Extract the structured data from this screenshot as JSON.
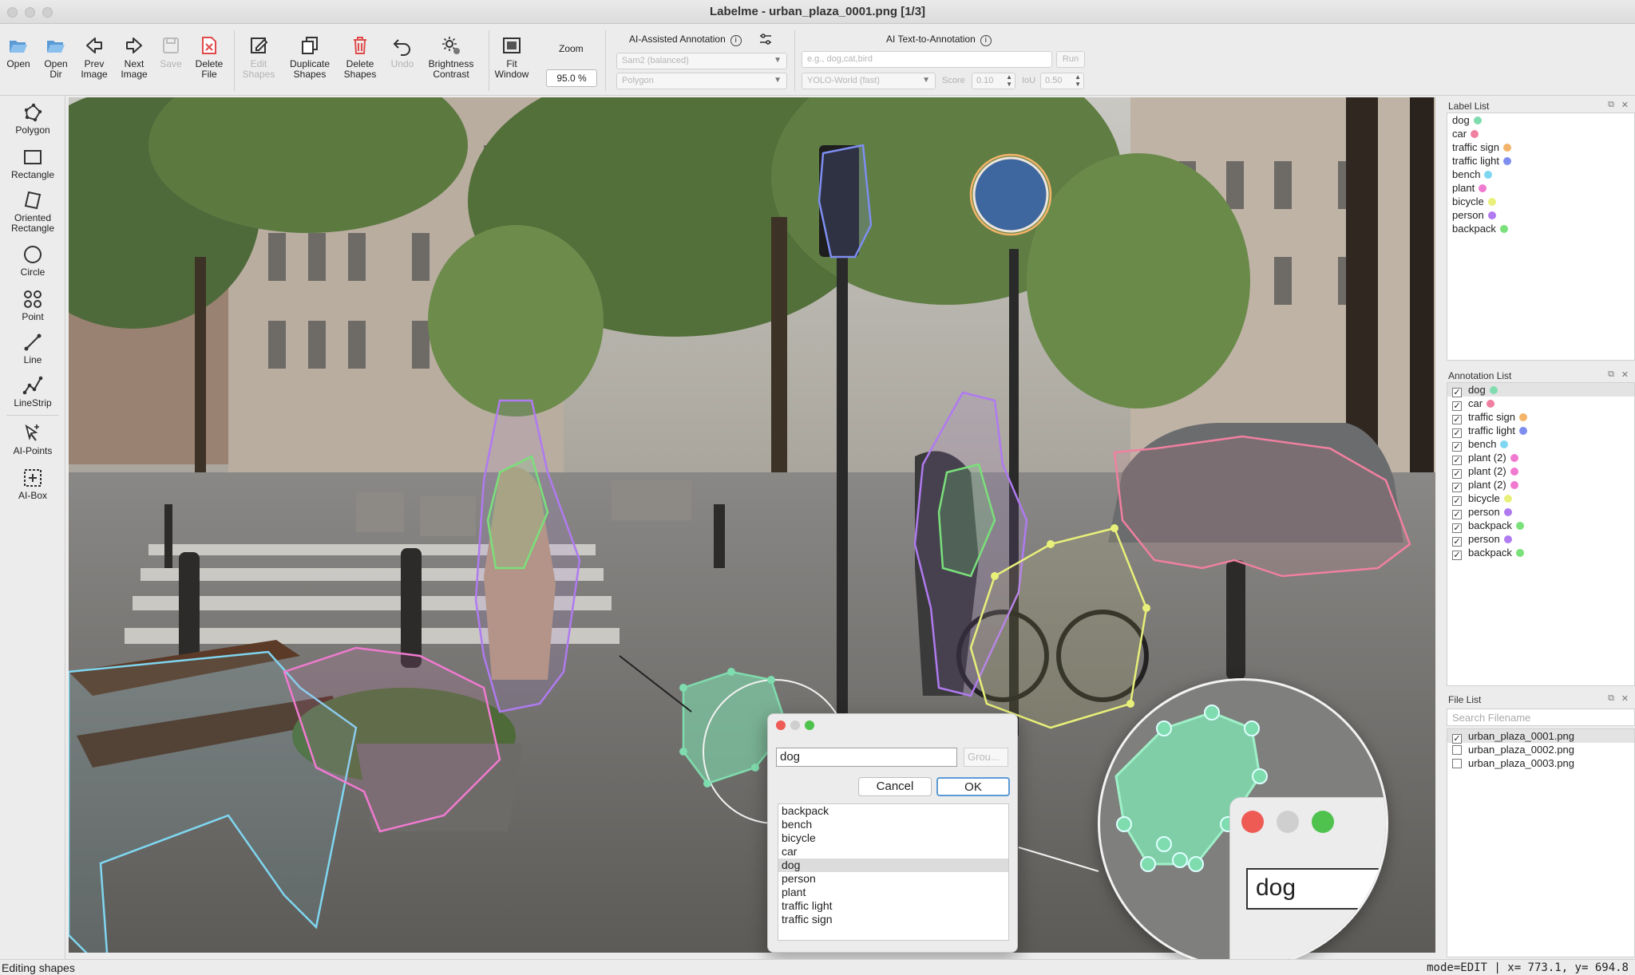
{
  "window": {
    "title": "Labelme - urban_plaza_0001.png [1/3]"
  },
  "toolbar": {
    "open": "Open",
    "open_dir": [
      "Open",
      "Dir"
    ],
    "prev_image": [
      "Prev",
      "Image"
    ],
    "next_image": [
      "Next",
      "Image"
    ],
    "save": "Save",
    "delete_file": [
      "Delete",
      "File"
    ],
    "edit_shapes": [
      "Edit",
      "Shapes"
    ],
    "duplicate_shapes": [
      "Duplicate",
      "Shapes"
    ],
    "delete_shapes": [
      "Delete",
      "Shapes"
    ],
    "undo": "Undo",
    "brightness_contrast": [
      "Brightness",
      "Contrast"
    ],
    "fit_window": [
      "Fit",
      "Window"
    ],
    "zoom_label": "Zoom",
    "zoom_value": "95.0 %"
  },
  "ai_assisted": {
    "title": "AI-Assisted Annotation",
    "model": "Sam2 (balanced)",
    "output": "Polygon"
  },
  "ai_text": {
    "title": "AI Text-to-Annotation",
    "prompt_placeholder": "e.g., dog,cat,bird",
    "run": "Run",
    "model": "YOLO-World (fast)",
    "score_label": "Score",
    "score_value": "0.10",
    "iou_label": "IoU",
    "iou_value": "0.50"
  },
  "tools": {
    "polygon": "Polygon",
    "rectangle": "Rectangle",
    "oriented_rectangle": [
      "Oriented",
      "Rectangle"
    ],
    "circle": "Circle",
    "point": "Point",
    "line": "Line",
    "linestrip": "LineStrip",
    "ai_points": "AI-Points",
    "ai_box": "AI-Box"
  },
  "label_dialog": {
    "input_value": "dog",
    "group_placeholder": "Grou...",
    "cancel": "Cancel",
    "ok": "OK",
    "labels": [
      "backpack",
      "bench",
      "bicycle",
      "car",
      "dog",
      "person",
      "plant",
      "traffic light",
      "traffic sign"
    ],
    "selected": "dog"
  },
  "magnifier": {
    "input_value": "dog"
  },
  "label_list": {
    "title": "Label List",
    "items": [
      {
        "label": "dog",
        "color": "#7fdcae"
      },
      {
        "label": "car",
        "color": "#f080a0"
      },
      {
        "label": "traffic sign",
        "color": "#f3b46a"
      },
      {
        "label": "traffic light",
        "color": "#7e8ef0"
      },
      {
        "label": "bench",
        "color": "#7fd6f0"
      },
      {
        "label": "plant",
        "color": "#f07ad0"
      },
      {
        "label": "bicycle",
        "color": "#e8f07a"
      },
      {
        "label": "person",
        "color": "#b07af0"
      },
      {
        "label": "backpack",
        "color": "#7ae07a"
      }
    ]
  },
  "annotation_list": {
    "title": "Annotation List",
    "items": [
      {
        "label": "dog",
        "color": "#7fdcae",
        "checked": true,
        "selected": true
      },
      {
        "label": "car",
        "color": "#f080a0",
        "checked": true
      },
      {
        "label": "traffic sign",
        "color": "#f3b46a",
        "checked": true
      },
      {
        "label": "traffic light",
        "color": "#7e8ef0",
        "checked": true
      },
      {
        "label": "bench",
        "color": "#7fd6f0",
        "checked": true
      },
      {
        "label": "plant (2)",
        "color": "#f07ad0",
        "checked": true
      },
      {
        "label": "plant (2)",
        "color": "#f07ad0",
        "checked": true
      },
      {
        "label": "plant (2)",
        "color": "#f07ad0",
        "checked": true
      },
      {
        "label": "bicycle",
        "color": "#e8f07a",
        "checked": true
      },
      {
        "label": "person",
        "color": "#b07af0",
        "checked": true
      },
      {
        "label": "backpack",
        "color": "#7ae07a",
        "checked": true
      },
      {
        "label": "person",
        "color": "#b07af0",
        "checked": true
      },
      {
        "label": "backpack",
        "color": "#7ae07a",
        "checked": true
      }
    ]
  },
  "file_list": {
    "title": "File List",
    "search_placeholder": "Search Filename",
    "items": [
      {
        "name": "urban_plaza_0001.png",
        "checked": true,
        "selected": true
      },
      {
        "name": "urban_plaza_0002.png",
        "checked": false
      },
      {
        "name": "urban_plaza_0003.png",
        "checked": false
      }
    ]
  },
  "status": {
    "left": "Editing shapes",
    "right": "mode=EDIT | x= 773.1, y= 694.8"
  }
}
